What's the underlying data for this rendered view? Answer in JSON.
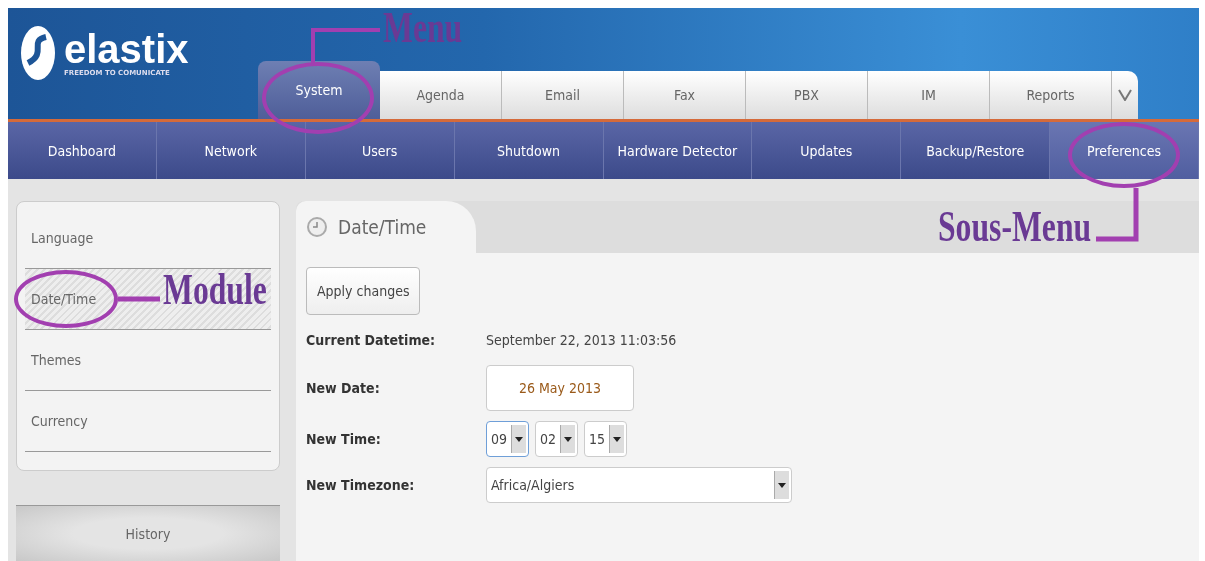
{
  "logo": {
    "name": "elastix",
    "tagline": "FREEDOM TO COMUNICATE"
  },
  "menu": [
    {
      "label": "System",
      "selected": true
    },
    {
      "label": "Agenda",
      "selected": false
    },
    {
      "label": "Email",
      "selected": false
    },
    {
      "label": "Fax",
      "selected": false
    },
    {
      "label": "PBX",
      "selected": false
    },
    {
      "label": "IM",
      "selected": false
    },
    {
      "label": "Reports",
      "selected": false
    }
  ],
  "submenu": [
    {
      "label": "Dashboard",
      "selected": false
    },
    {
      "label": "Network",
      "selected": false
    },
    {
      "label": "Users",
      "selected": false
    },
    {
      "label": "Shutdown",
      "selected": false
    },
    {
      "label": "Hardware Detector",
      "selected": false
    },
    {
      "label": "Updates",
      "selected": false
    },
    {
      "label": "Backup/Restore",
      "selected": false
    },
    {
      "label": "Preferences",
      "selected": true
    }
  ],
  "modules": [
    {
      "label": "Language",
      "selected": false
    },
    {
      "label": "Date/Time",
      "selected": true
    },
    {
      "label": "Themes",
      "selected": false
    },
    {
      "label": "Currency",
      "selected": false
    }
  ],
  "history": "History",
  "panel": {
    "title": "Date/Time",
    "apply_button": "Apply changes",
    "fields": [
      {
        "kind": "text",
        "label": "Current Datetime:",
        "value": "September 22, 2013 11:03:56"
      },
      {
        "kind": "date",
        "label": "New Date:",
        "value": "26 May 2013"
      },
      {
        "kind": "time",
        "label": "New Time:",
        "values": [
          "09",
          "02",
          "15"
        ]
      },
      {
        "kind": "select",
        "label": "New Timezone:",
        "value": "Africa/Algiers"
      }
    ]
  },
  "annotations": [
    {
      "kind": "menu",
      "text": "Menu"
    },
    {
      "kind": "module",
      "text": "Module"
    },
    {
      "kind": "submenu",
      "text": "Sous-Menu"
    }
  ]
}
